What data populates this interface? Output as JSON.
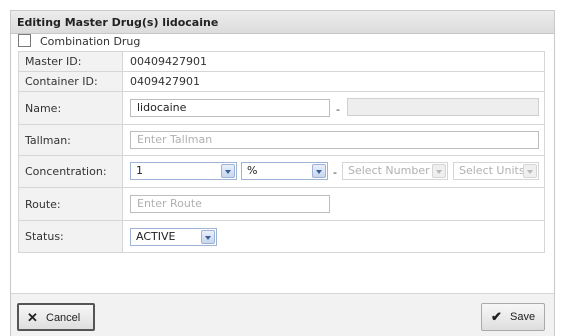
{
  "dialog": {
    "title": "Editing Master Drug(s) lidocaine"
  },
  "combination": {
    "label": "Combination Drug",
    "checked": false
  },
  "fields": {
    "master_id": {
      "label": "Master ID:",
      "value": "00409427901"
    },
    "container_id": {
      "label": "Container ID:",
      "value": "0409427901"
    },
    "name": {
      "label": "Name:",
      "value": "lidocaine",
      "separator": "-"
    },
    "tallman": {
      "label": "Tallman:",
      "placeholder": "Enter Tallman"
    },
    "concentration": {
      "label": "Concentration:",
      "value": "1",
      "unit": "%",
      "separator": "-",
      "number_placeholder": "Select Number",
      "units_placeholder": "Select Units"
    },
    "route": {
      "label": "Route:",
      "placeholder": "Enter Route"
    },
    "status": {
      "label": "Status:",
      "value": "ACTIVE"
    }
  },
  "buttons": {
    "cancel": {
      "label": "Cancel",
      "icon": "x-icon"
    },
    "save": {
      "label": "Save",
      "icon": "checkmark-icon"
    }
  },
  "colors": {
    "title_bar": "#dcdcdc",
    "label_cell": "#f2f2f2",
    "select_border": "#9fb3d6"
  }
}
